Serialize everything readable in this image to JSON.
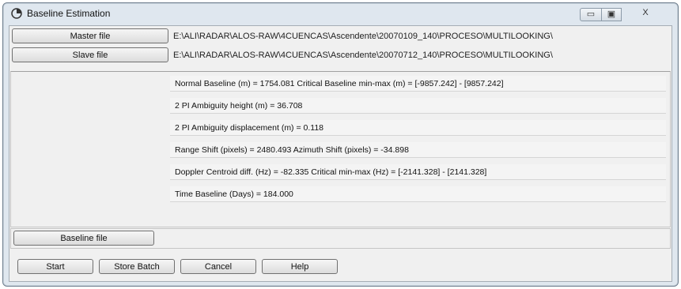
{
  "window": {
    "title": "Baseline Estimation",
    "controls": {
      "minimize": "▭",
      "maximize": "▣",
      "close": "X"
    }
  },
  "files": {
    "master_label": "Master file",
    "master_path": "E:\\ALI\\RADAR\\ALOS-RAW\\4CUENCAS\\Ascendente\\20070109_140\\PROCESO\\MULTILOOKING\\",
    "slave_label": "Slave file",
    "slave_path": "E:\\ALI\\RADAR\\ALOS-RAW\\4CUENCAS\\Ascendente\\20070712_140\\PROCESO\\MULTILOOKING\\"
  },
  "results": [
    "Normal Baseline (m) = 1754.081    Critical Baseline min-max (m) = [-9857.242] - [9857.242]",
    "2 PI Ambiguity height (m) = 36.708",
    "2 PI Ambiguity displacement (m) = 0.118",
    "Range Shift (pixels)    = 2480.493    Azimuth Shift (pixels)  = -34.898",
    "Doppler Centroid diff. (Hz) = -82.335    Critical min-max (Hz) = [-2141.328] - [2141.328]",
    "Time Baseline (Days) = 184.000"
  ],
  "baseline_file": {
    "label": "Baseline file",
    "value": ""
  },
  "buttons": {
    "start": "Start",
    "store_batch": "Store Batch",
    "cancel": "Cancel",
    "help": "Help"
  }
}
